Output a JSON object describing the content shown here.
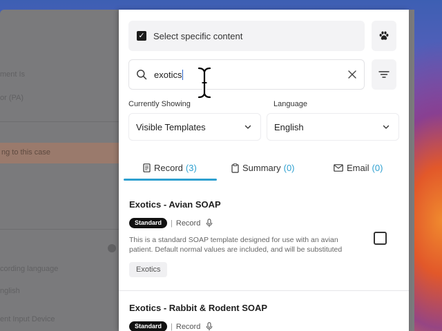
{
  "background": {
    "items": [
      "ment Is",
      "or (PA)",
      "ng to this case",
      "cording language",
      "nglish",
      "ent Input Device"
    ]
  },
  "selection": {
    "label": "Select specific content",
    "checked": true
  },
  "search": {
    "value": "exotics",
    "placeholder": ""
  },
  "filters": {
    "showing": {
      "label": "Currently Showing",
      "value": "Visible Templates"
    },
    "language": {
      "label": "Language",
      "value": "English"
    }
  },
  "tabs": [
    {
      "label": "Record",
      "count": "(3)",
      "icon": "document-icon",
      "active": true
    },
    {
      "label": "Summary",
      "count": "(0)",
      "icon": "clipboard-icon",
      "active": false
    },
    {
      "label": "Email",
      "count": "(0)",
      "icon": "envelope-icon",
      "active": false
    }
  ],
  "templates": [
    {
      "title": "Exotics - Avian SOAP",
      "badge": "Standard",
      "type": "Record",
      "description": "This is a standard SOAP template designed for use with an avian patient. Default normal values are included, and will be substituted",
      "tag": "Exotics",
      "selected": false
    },
    {
      "title": "Exotics - Rabbit & Rodent SOAP",
      "badge": "Standard",
      "type": "Record"
    }
  ],
  "colors": {
    "accent": "#2ea0d0",
    "badge": "#111111"
  }
}
